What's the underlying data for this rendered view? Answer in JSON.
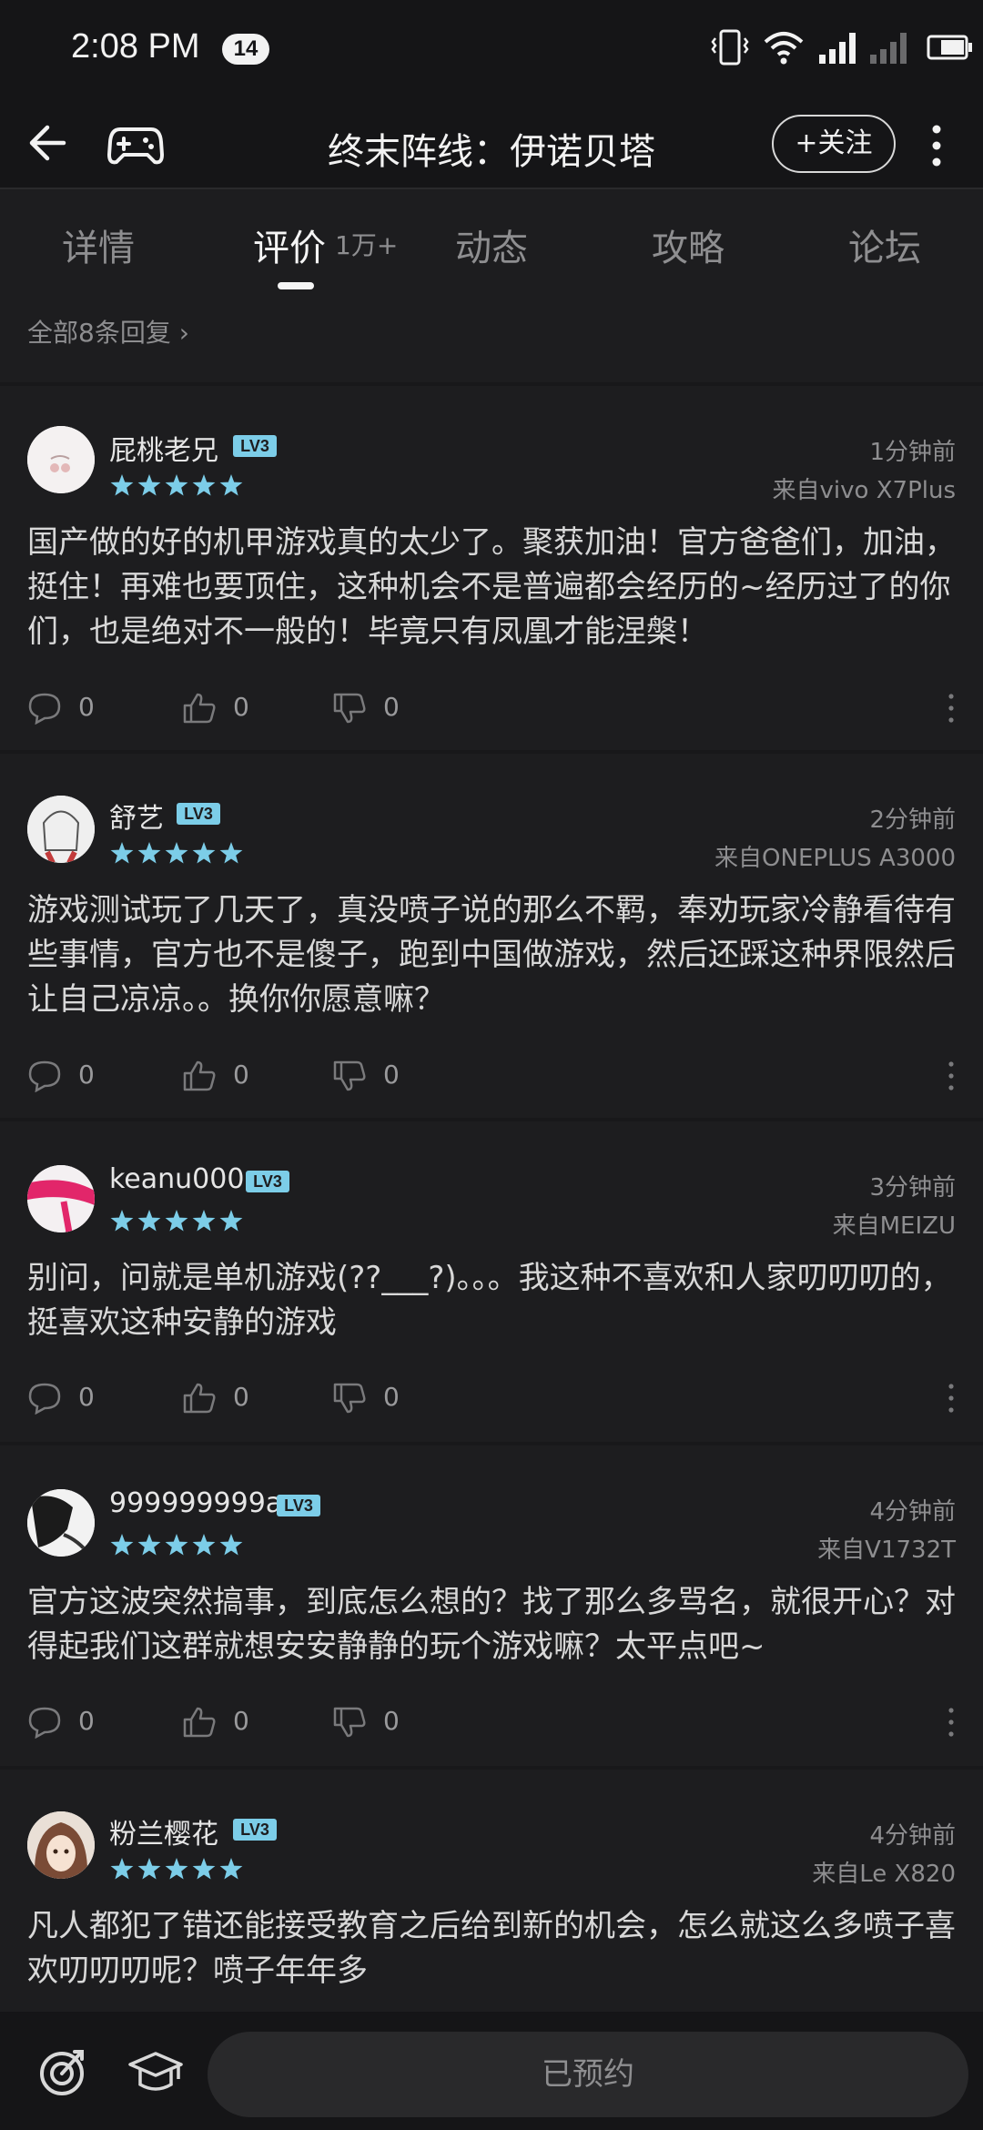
{
  "status_bar": {
    "time": "2:08 PM",
    "notification_count": "14"
  },
  "header": {
    "title": "终末阵线：伊诺贝塔",
    "follow_label": "+关注"
  },
  "tabs": [
    {
      "label": "详情",
      "active": false
    },
    {
      "label": "评价",
      "active": true,
      "count": "1万+"
    },
    {
      "label": "动态",
      "active": false
    },
    {
      "label": "攻略",
      "active": false
    },
    {
      "label": "论坛",
      "active": false
    }
  ],
  "all_replies_label": "全部8条回复",
  "accent_color": "#7ccde8",
  "reviews": [
    {
      "username": "屁桃老兄",
      "level": "LV3",
      "rating": 5,
      "time": "1分钟前",
      "device": "来自vivo X7Plus",
      "content": "国产做的好的机甲游戏真的太少了。聚获加油！官方爸爸们，加油，挺住！再难也要顶住，这种机会不是普遍都会经历的~经历过了的你们，也是绝对不一般的！毕竟只有凤凰才能涅槃！",
      "comments": "0",
      "likes": "0",
      "dislikes": "0"
    },
    {
      "username": "舒艺",
      "level": "LV3",
      "rating": 5,
      "time": "2分钟前",
      "device": "来自ONEPLUS A3000",
      "content": "游戏测试玩了几天了，真没喷子说的那么不羁，奉劝玩家冷静看待有些事情，官方也不是傻子，跑到中国做游戏，然后还踩这种界限然后让自己凉凉。。换你你愿意嘛？",
      "comments": "0",
      "likes": "0",
      "dislikes": "0"
    },
    {
      "username": "keanu000",
      "level": "LV3",
      "rating": 5,
      "time": "3分钟前",
      "device": "来自MEIZU",
      "content": "别问，问就是单机游戏(??___?)。。。我这种不喜欢和人家叨叨叨的，挺喜欢这种安静的游戏",
      "comments": "0",
      "likes": "0",
      "dislikes": "0"
    },
    {
      "username": "999999999a",
      "level": "LV3",
      "rating": 5,
      "time": "4分钟前",
      "device": "来自V1732T",
      "content": "官方这波突然搞事，到底怎么想的？找了那么多骂名，就很开心？对得起我们这群就想安安静静的玩个游戏嘛？太平点吧~",
      "comments": "0",
      "likes": "0",
      "dislikes": "0"
    },
    {
      "username": "粉兰樱花",
      "level": "LV3",
      "rating": 5,
      "time": "4分钟前",
      "device": "来自Le X820",
      "content": "凡人都犯了错还能接受教育之后给到新的机会，怎么就这么多喷子喜欢叨叨叨呢？喷子年年多"
    }
  ],
  "bottom_bar": {
    "reserve_label": "已预约"
  }
}
